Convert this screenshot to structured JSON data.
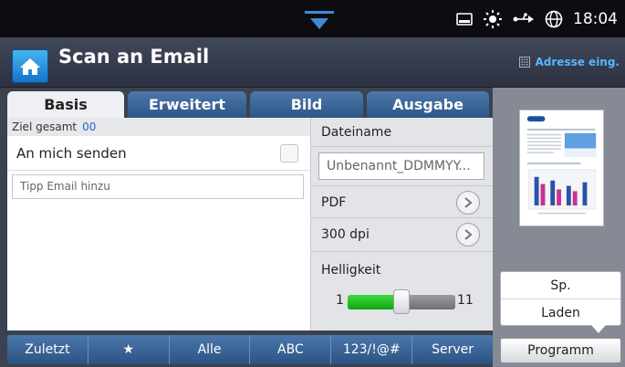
{
  "statusbar": {
    "clock": "18:04",
    "icons": [
      "storage-icon",
      "sun-icon",
      "network-icon",
      "globe-icon"
    ]
  },
  "header": {
    "title": "Scan an Email",
    "address_entry_label": "Adresse eing."
  },
  "tabs": [
    {
      "label": "Basis",
      "active": true
    },
    {
      "label": "Erweitert",
      "active": false
    },
    {
      "label": "Bild",
      "active": false
    },
    {
      "label": "Ausgabe",
      "active": false
    }
  ],
  "recipients": {
    "total_label": "Ziel gesamt",
    "total_count": "00",
    "send_to_me_label": "An mich senden",
    "send_to_me_checked": false,
    "email_input_placeholder": "Tipp Email hinzu"
  },
  "settings": {
    "filename_label": "Dateiname",
    "filename_value": "Unbenannt_DDMMYY...",
    "format_value": "PDF",
    "resolution_value": "300 dpi",
    "brightness_label": "Helligkeit",
    "brightness_min": "1",
    "brightness_max": "11",
    "brightness_value": 6
  },
  "bottombar": {
    "items": [
      "Zuletzt",
      "★",
      "Alle",
      "ABC",
      "123/!@#",
      "Server"
    ]
  },
  "preview": {
    "popup_items": [
      "Sp.",
      "Laden"
    ],
    "program_label": "Programm"
  },
  "colors": {
    "accent_blue": "#2e5586",
    "home_blue": "#1672c9",
    "slider_green": "#1cbf1c",
    "address_blue": "#57b6ff"
  }
}
